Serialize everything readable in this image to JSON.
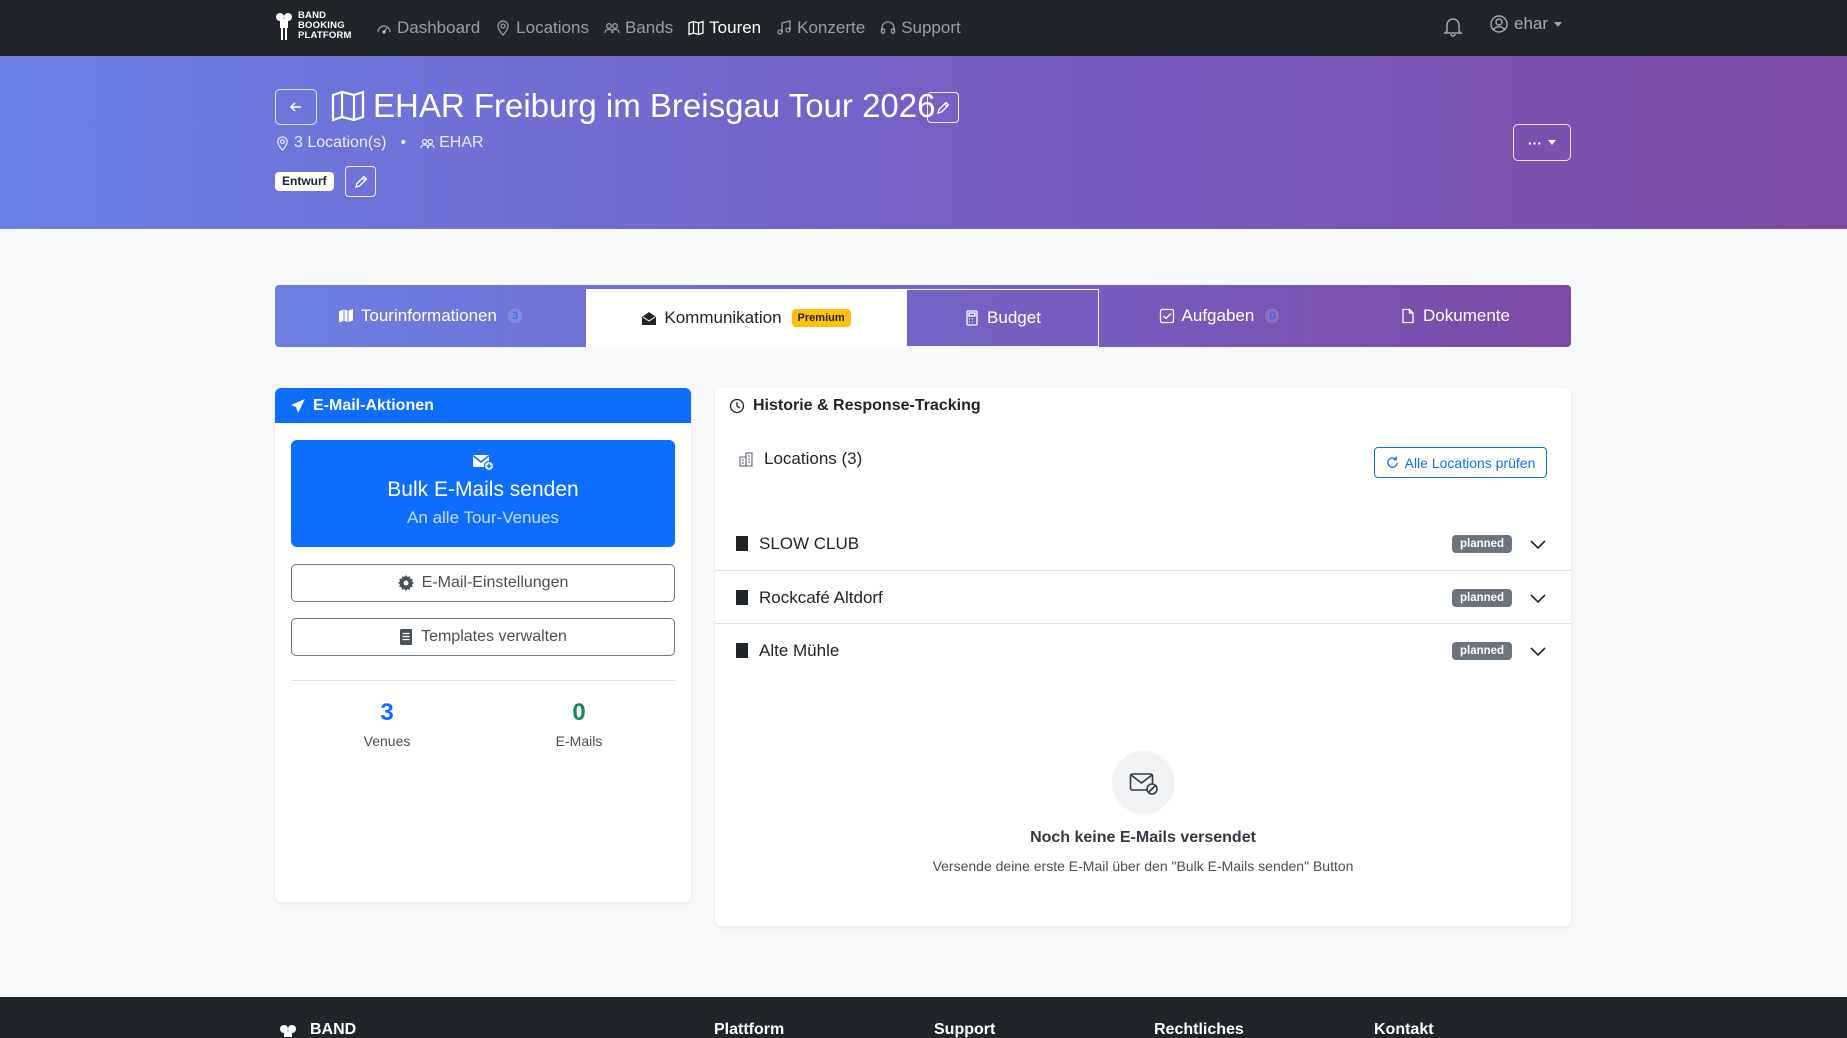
{
  "brand": {
    "logo_line1": "BAND",
    "logo_line2": "BOOKING",
    "logo_line3": "PLATFORM"
  },
  "nav": {
    "items": [
      {
        "label": "Dashboard",
        "icon": "speedometer-icon"
      },
      {
        "label": "Locations",
        "icon": "geo-pin-icon"
      },
      {
        "label": "Bands",
        "icon": "people-icon"
      },
      {
        "label": "Touren",
        "icon": "map-icon",
        "active": true
      },
      {
        "label": "Konzerte",
        "icon": "music-note-icon"
      },
      {
        "label": "Support",
        "icon": "headset-icon"
      }
    ],
    "user": "ehar"
  },
  "hero": {
    "title": "EHAR Freiburg im Breisgau Tour 2026",
    "locations": "3 Location(s)",
    "dot": "•",
    "band": "EHAR",
    "status": "Entwurf",
    "more": "···"
  },
  "tabs": [
    {
      "label": "Tourinformationen",
      "count": "3"
    },
    {
      "label": "Kommunikation",
      "badge": "Premium",
      "active": true
    },
    {
      "label": "Budget"
    },
    {
      "label": "Aufgaben",
      "count": "0"
    },
    {
      "label": "Dokumente"
    }
  ],
  "actions": {
    "header": "E-Mail-Aktionen",
    "bulk_title": "Bulk E-Mails senden",
    "bulk_sub": "An alle Tour-Venues",
    "settings": "E-Mail-Einstellungen",
    "templates": "Templates verwalten",
    "stats": [
      {
        "value": "3",
        "label": "Venues",
        "color": "#0d6efd"
      },
      {
        "value": "0",
        "label": "E-Mails",
        "color": "#198754"
      }
    ]
  },
  "history": {
    "header": "Historie & Response-Tracking",
    "locations_label": "Locations (3)",
    "check_button": "Alle Locations prüfen",
    "rows": [
      {
        "name": "SLOW CLUB",
        "status": "planned"
      },
      {
        "name": "Rockcafé Altdorf",
        "status": "planned"
      },
      {
        "name": "Alte Mühle",
        "status": "planned"
      }
    ],
    "empty_title": "Noch keine E-Mails versendet",
    "empty_sub": "Versende deine erste E-Mail über den \"Bulk E-Mails senden\" Button"
  },
  "footer": {
    "brand": "BAND",
    "cols": [
      "Plattform",
      "Support",
      "Rechtliches",
      "Kontakt"
    ]
  },
  "colors": {
    "primary": "#0d6efd",
    "navbar": "#212529",
    "success": "#198754",
    "warning": "#ffc107"
  }
}
